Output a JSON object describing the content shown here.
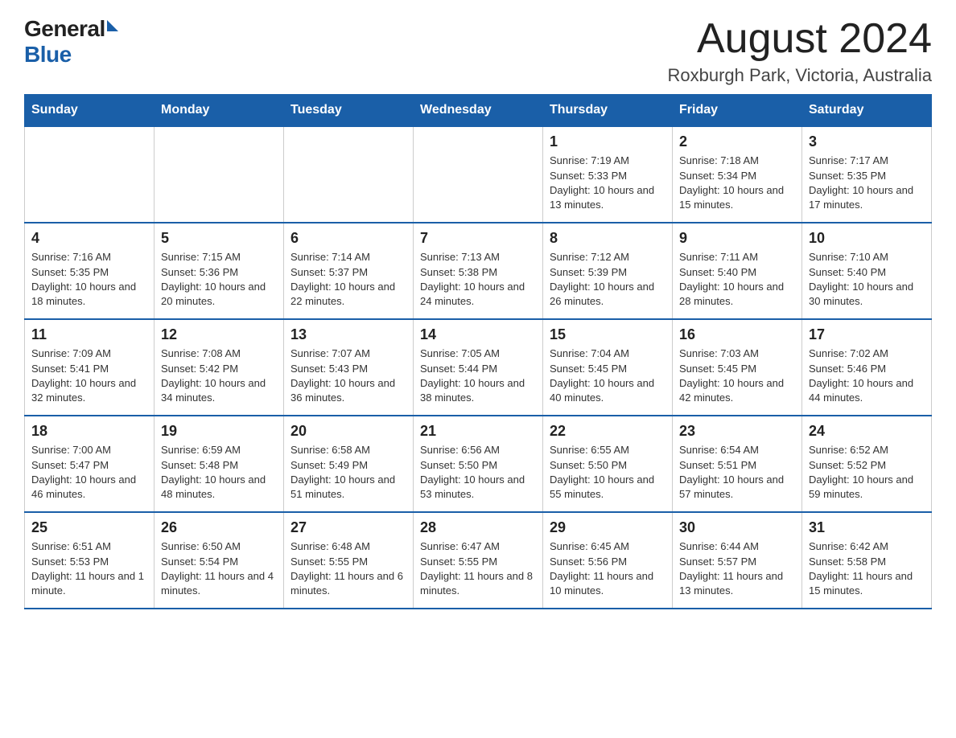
{
  "header": {
    "logo_general": "General",
    "logo_blue": "Blue",
    "month": "August 2024",
    "location": "Roxburgh Park, Victoria, Australia"
  },
  "weekdays": [
    "Sunday",
    "Monday",
    "Tuesday",
    "Wednesday",
    "Thursday",
    "Friday",
    "Saturday"
  ],
  "weeks": [
    [
      {
        "day": "",
        "sunrise": "",
        "sunset": "",
        "daylight": ""
      },
      {
        "day": "",
        "sunrise": "",
        "sunset": "",
        "daylight": ""
      },
      {
        "day": "",
        "sunrise": "",
        "sunset": "",
        "daylight": ""
      },
      {
        "day": "",
        "sunrise": "",
        "sunset": "",
        "daylight": ""
      },
      {
        "day": "1",
        "sunrise": "Sunrise: 7:19 AM",
        "sunset": "Sunset: 5:33 PM",
        "daylight": "Daylight: 10 hours and 13 minutes."
      },
      {
        "day": "2",
        "sunrise": "Sunrise: 7:18 AM",
        "sunset": "Sunset: 5:34 PM",
        "daylight": "Daylight: 10 hours and 15 minutes."
      },
      {
        "day": "3",
        "sunrise": "Sunrise: 7:17 AM",
        "sunset": "Sunset: 5:35 PM",
        "daylight": "Daylight: 10 hours and 17 minutes."
      }
    ],
    [
      {
        "day": "4",
        "sunrise": "Sunrise: 7:16 AM",
        "sunset": "Sunset: 5:35 PM",
        "daylight": "Daylight: 10 hours and 18 minutes."
      },
      {
        "day": "5",
        "sunrise": "Sunrise: 7:15 AM",
        "sunset": "Sunset: 5:36 PM",
        "daylight": "Daylight: 10 hours and 20 minutes."
      },
      {
        "day": "6",
        "sunrise": "Sunrise: 7:14 AM",
        "sunset": "Sunset: 5:37 PM",
        "daylight": "Daylight: 10 hours and 22 minutes."
      },
      {
        "day": "7",
        "sunrise": "Sunrise: 7:13 AM",
        "sunset": "Sunset: 5:38 PM",
        "daylight": "Daylight: 10 hours and 24 minutes."
      },
      {
        "day": "8",
        "sunrise": "Sunrise: 7:12 AM",
        "sunset": "Sunset: 5:39 PM",
        "daylight": "Daylight: 10 hours and 26 minutes."
      },
      {
        "day": "9",
        "sunrise": "Sunrise: 7:11 AM",
        "sunset": "Sunset: 5:40 PM",
        "daylight": "Daylight: 10 hours and 28 minutes."
      },
      {
        "day": "10",
        "sunrise": "Sunrise: 7:10 AM",
        "sunset": "Sunset: 5:40 PM",
        "daylight": "Daylight: 10 hours and 30 minutes."
      }
    ],
    [
      {
        "day": "11",
        "sunrise": "Sunrise: 7:09 AM",
        "sunset": "Sunset: 5:41 PM",
        "daylight": "Daylight: 10 hours and 32 minutes."
      },
      {
        "day": "12",
        "sunrise": "Sunrise: 7:08 AM",
        "sunset": "Sunset: 5:42 PM",
        "daylight": "Daylight: 10 hours and 34 minutes."
      },
      {
        "day": "13",
        "sunrise": "Sunrise: 7:07 AM",
        "sunset": "Sunset: 5:43 PM",
        "daylight": "Daylight: 10 hours and 36 minutes."
      },
      {
        "day": "14",
        "sunrise": "Sunrise: 7:05 AM",
        "sunset": "Sunset: 5:44 PM",
        "daylight": "Daylight: 10 hours and 38 minutes."
      },
      {
        "day": "15",
        "sunrise": "Sunrise: 7:04 AM",
        "sunset": "Sunset: 5:45 PM",
        "daylight": "Daylight: 10 hours and 40 minutes."
      },
      {
        "day": "16",
        "sunrise": "Sunrise: 7:03 AM",
        "sunset": "Sunset: 5:45 PM",
        "daylight": "Daylight: 10 hours and 42 minutes."
      },
      {
        "day": "17",
        "sunrise": "Sunrise: 7:02 AM",
        "sunset": "Sunset: 5:46 PM",
        "daylight": "Daylight: 10 hours and 44 minutes."
      }
    ],
    [
      {
        "day": "18",
        "sunrise": "Sunrise: 7:00 AM",
        "sunset": "Sunset: 5:47 PM",
        "daylight": "Daylight: 10 hours and 46 minutes."
      },
      {
        "day": "19",
        "sunrise": "Sunrise: 6:59 AM",
        "sunset": "Sunset: 5:48 PM",
        "daylight": "Daylight: 10 hours and 48 minutes."
      },
      {
        "day": "20",
        "sunrise": "Sunrise: 6:58 AM",
        "sunset": "Sunset: 5:49 PM",
        "daylight": "Daylight: 10 hours and 51 minutes."
      },
      {
        "day": "21",
        "sunrise": "Sunrise: 6:56 AM",
        "sunset": "Sunset: 5:50 PM",
        "daylight": "Daylight: 10 hours and 53 minutes."
      },
      {
        "day": "22",
        "sunrise": "Sunrise: 6:55 AM",
        "sunset": "Sunset: 5:50 PM",
        "daylight": "Daylight: 10 hours and 55 minutes."
      },
      {
        "day": "23",
        "sunrise": "Sunrise: 6:54 AM",
        "sunset": "Sunset: 5:51 PM",
        "daylight": "Daylight: 10 hours and 57 minutes."
      },
      {
        "day": "24",
        "sunrise": "Sunrise: 6:52 AM",
        "sunset": "Sunset: 5:52 PM",
        "daylight": "Daylight: 10 hours and 59 minutes."
      }
    ],
    [
      {
        "day": "25",
        "sunrise": "Sunrise: 6:51 AM",
        "sunset": "Sunset: 5:53 PM",
        "daylight": "Daylight: 11 hours and 1 minute."
      },
      {
        "day": "26",
        "sunrise": "Sunrise: 6:50 AM",
        "sunset": "Sunset: 5:54 PM",
        "daylight": "Daylight: 11 hours and 4 minutes."
      },
      {
        "day": "27",
        "sunrise": "Sunrise: 6:48 AM",
        "sunset": "Sunset: 5:55 PM",
        "daylight": "Daylight: 11 hours and 6 minutes."
      },
      {
        "day": "28",
        "sunrise": "Sunrise: 6:47 AM",
        "sunset": "Sunset: 5:55 PM",
        "daylight": "Daylight: 11 hours and 8 minutes."
      },
      {
        "day": "29",
        "sunrise": "Sunrise: 6:45 AM",
        "sunset": "Sunset: 5:56 PM",
        "daylight": "Daylight: 11 hours and 10 minutes."
      },
      {
        "day": "30",
        "sunrise": "Sunrise: 6:44 AM",
        "sunset": "Sunset: 5:57 PM",
        "daylight": "Daylight: 11 hours and 13 minutes."
      },
      {
        "day": "31",
        "sunrise": "Sunrise: 6:42 AM",
        "sunset": "Sunset: 5:58 PM",
        "daylight": "Daylight: 11 hours and 15 minutes."
      }
    ]
  ]
}
